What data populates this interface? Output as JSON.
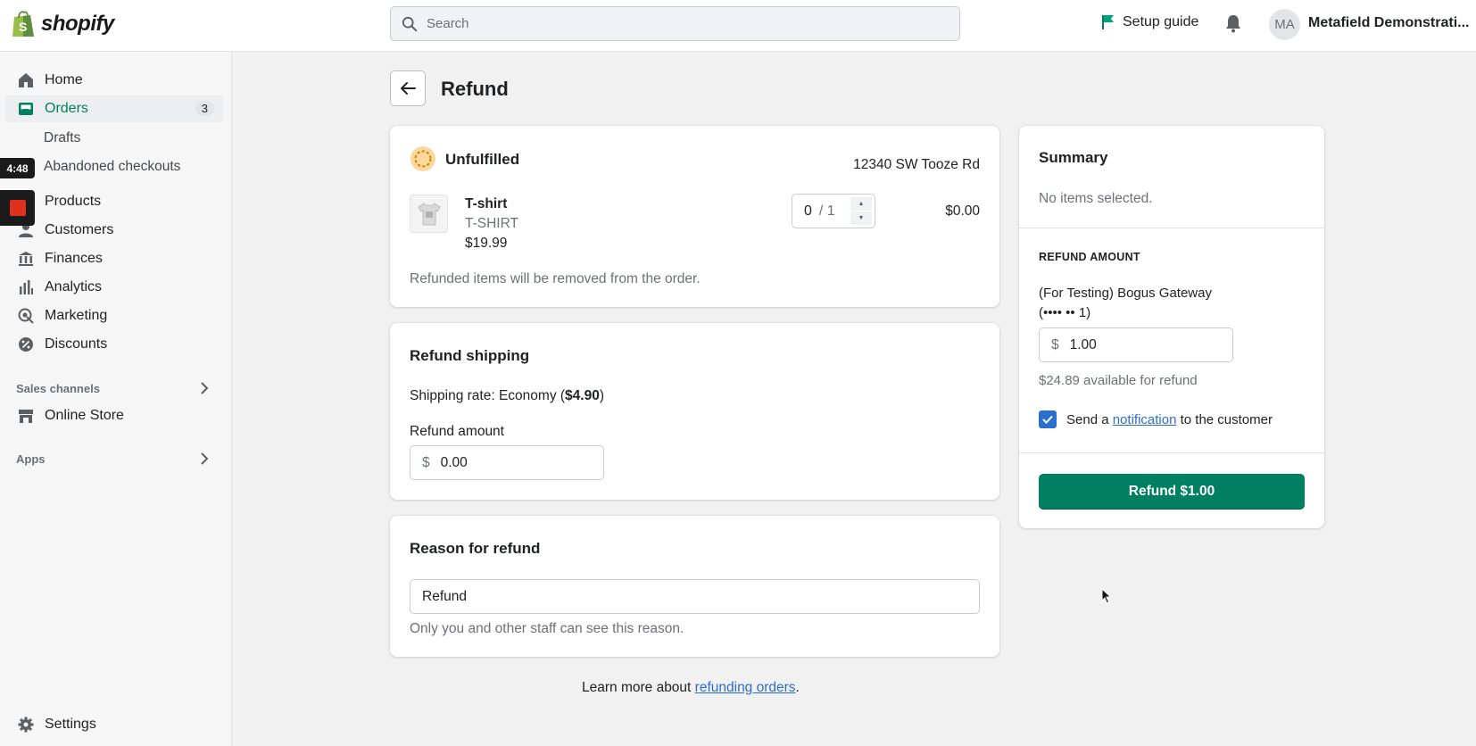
{
  "topbar": {
    "logo_text": "shopify",
    "search_placeholder": "Search",
    "setup_guide": "Setup guide",
    "avatar_initials": "MA",
    "store_name": "Metafield Demonstrati..."
  },
  "sidebar": {
    "items": [
      {
        "label": "Home",
        "icon": "home-icon"
      },
      {
        "label": "Orders",
        "icon": "orders-icon",
        "badge": "3"
      },
      {
        "label": "Drafts"
      },
      {
        "label": "Abandoned checkouts"
      },
      {
        "label": "Products",
        "icon": "products-icon"
      },
      {
        "label": "Customers",
        "icon": "customers-icon"
      },
      {
        "label": "Finances",
        "icon": "finances-icon"
      },
      {
        "label": "Analytics",
        "icon": "analytics-icon"
      },
      {
        "label": "Marketing",
        "icon": "marketing-icon"
      },
      {
        "label": "Discounts",
        "icon": "discounts-icon"
      }
    ],
    "sales_channels": "Sales channels",
    "online_store": "Online Store",
    "apps": "Apps",
    "settings": "Settings"
  },
  "overlay": {
    "timer": "4:48"
  },
  "page": {
    "title": "Refund"
  },
  "unfulfilled": {
    "status": "Unfulfilled",
    "address": "12340 SW Tooze Rd",
    "product_name": "T-shirt",
    "product_sku": "T-SHIRT",
    "product_price": "$19.99",
    "qty_value": "0",
    "qty_total": "/ 1",
    "line_total": "$0.00",
    "note": "Refunded items will be removed from the order."
  },
  "shipping": {
    "title": "Refund shipping",
    "rate_prefix": "Shipping rate: Economy (",
    "rate_amount": "$4.90",
    "rate_suffix": ")",
    "amount_label": "Refund amount",
    "currency": "$",
    "amount_value": "0.00"
  },
  "reason": {
    "title": "Reason for refund",
    "value": "Refund",
    "help": "Only you and other staff can see this reason."
  },
  "summary": {
    "title": "Summary",
    "no_items": "No items selected.",
    "refund_amount_heading": "REFUND AMOUNT",
    "gateway_line1": "(For Testing) Bogus Gateway",
    "gateway_line2": "(•••• •• 1)",
    "currency": "$",
    "amount_value": "1.00",
    "available": "$24.89 available for refund",
    "notify_prefix": "Send a ",
    "notify_link": "notification",
    "notify_suffix": " to the customer",
    "refund_button": "Refund $1.00"
  },
  "footer": {
    "learn_prefix": "Learn more about ",
    "learn_link": "refunding orders",
    "learn_suffix": "."
  },
  "colors": {
    "primary_green": "#008060",
    "link_blue": "#2c6ecb",
    "active_nav": "#008060",
    "unfulfilled_badge": "#f5c26b"
  }
}
